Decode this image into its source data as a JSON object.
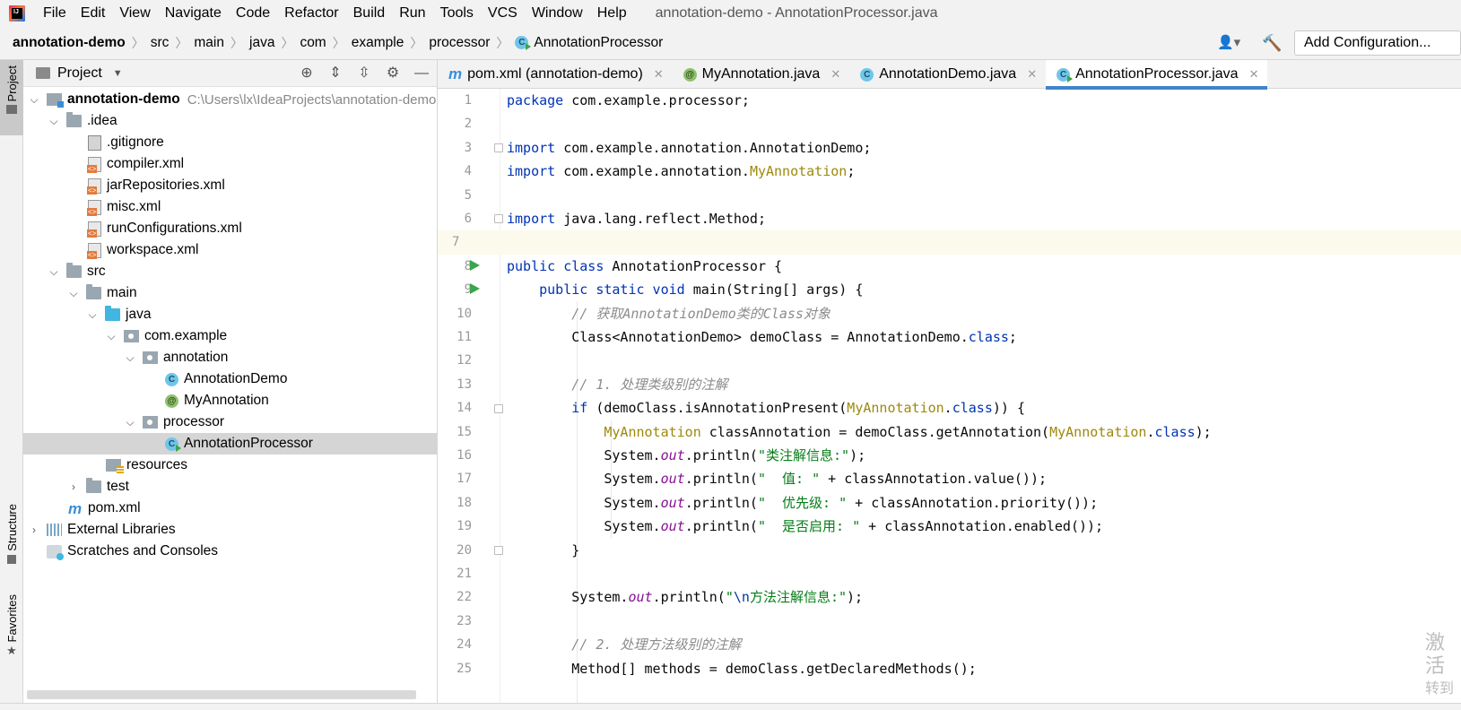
{
  "menubar": {
    "items": [
      "File",
      "Edit",
      "View",
      "Navigate",
      "Code",
      "Refactor",
      "Build",
      "Run",
      "Tools",
      "VCS",
      "Window",
      "Help"
    ],
    "window_title": "annotation-demo - AnnotationProcessor.java"
  },
  "breadcrumb": {
    "items": [
      "annotation-demo",
      "src",
      "main",
      "java",
      "com",
      "example",
      "processor",
      "AnnotationProcessor"
    ],
    "add_configuration": "Add Configuration..."
  },
  "leftstrip": {
    "project": "Project",
    "structure": "Structure",
    "favorites": "Favorites"
  },
  "project_panel": {
    "title": "Project",
    "root_name": "annotation-demo",
    "root_path": "C:\\Users\\lx\\IdeaProjects\\annotation-demo",
    "rows": [
      {
        "label": ".idea"
      },
      {
        "label": ".gitignore"
      },
      {
        "label": "compiler.xml"
      },
      {
        "label": "jarRepositories.xml"
      },
      {
        "label": "misc.xml"
      },
      {
        "label": "runConfigurations.xml"
      },
      {
        "label": "workspace.xml"
      },
      {
        "label": "src"
      },
      {
        "label": "main"
      },
      {
        "label": "java"
      },
      {
        "label": "com.example"
      },
      {
        "label": "annotation"
      },
      {
        "label": "AnnotationDemo"
      },
      {
        "label": "MyAnnotation"
      },
      {
        "label": "processor"
      },
      {
        "label": "AnnotationProcessor"
      },
      {
        "label": "resources"
      },
      {
        "label": "test"
      },
      {
        "label": "pom.xml"
      },
      {
        "label": "External Libraries"
      },
      {
        "label": "Scratches and Consoles"
      }
    ]
  },
  "editor": {
    "tabs": [
      {
        "label": "pom.xml (annotation-demo)"
      },
      {
        "label": "MyAnnotation.java"
      },
      {
        "label": "AnnotationDemo.java"
      },
      {
        "label": "AnnotationProcessor.java"
      }
    ],
    "line_numbers": [
      "1",
      "2",
      "3",
      "4",
      "5",
      "6",
      "7",
      "8",
      "9",
      "10",
      "11",
      "12",
      "13",
      "14",
      "15",
      "16",
      "17",
      "18",
      "19",
      "20",
      "21",
      "22",
      "23",
      "24",
      "25"
    ],
    "code": {
      "l1_kw": "package",
      "l1_rest": " com.example.processor;",
      "l3_kw": "import",
      "l3_rest": " com.example.annotation.AnnotationDemo;",
      "l4_kw": "import",
      "l4_rest": " com.example.annotation.",
      "l4_an": "MyAnnotation",
      "l4_end": ";",
      "l6_kw": "import",
      "l6_rest": " java.lang.reflect.Method;",
      "l8_kw": "public class",
      "l8_rest": " AnnotationProcessor {",
      "l9_kw": "    public static void",
      "l9_rest": " main(String[] args) {",
      "l10_cm": "        // 获取AnnotationDemo类的Class对象",
      "l11_a": "        Class<AnnotationDemo> demoClass = AnnotationDemo.",
      "l11_kw": "class",
      "l11_end": ";",
      "l13_cm": "        // 1. 处理类级别的注解",
      "l14_kw": "        if",
      "l14_a": " (demoClass.isAnnotationPresent(",
      "l14_an": "MyAnnotation",
      "l14_b": ".",
      "l14_kw2": "class",
      "l14_end": ")) {",
      "l15_an": "            MyAnnotation",
      "l15_a": " classAnnotation = demoClass.getAnnotation(",
      "l15_an2": "MyAnnotation",
      "l15_b": ".",
      "l15_kw": "class",
      "l15_end": ");",
      "l16_a": "            System.",
      "l16_it": "out",
      "l16_b": ".println(",
      "l16_st": "\"类注解信息:\"",
      "l16_end": ");",
      "l17_a": "            System.",
      "l17_it": "out",
      "l17_b": ".println(",
      "l17_st": "\"  值: \"",
      "l17_end": " + classAnnotation.value());",
      "l18_a": "            System.",
      "l18_it": "out",
      "l18_b": ".println(",
      "l18_st": "\"  优先级: \"",
      "l18_end": " + classAnnotation.priority());",
      "l19_a": "            System.",
      "l19_it": "out",
      "l19_b": ".println(",
      "l19_st": "\"  是否启用: \"",
      "l19_end": " + classAnnotation.enabled());",
      "l20": "        }",
      "l22_a": "        System.",
      "l22_it": "out",
      "l22_b": ".println(",
      "l22_q": "\"",
      "l22_esc": "\\n",
      "l22_st": "方法注解信息:\"",
      "l22_end": ");",
      "l24_cm": "        // 2. 处理方法级别的注解",
      "l25": "        Method[] methods = demoClass.getDeclaredMethods();"
    }
  },
  "watermark": {
    "line1": "激活",
    "line2": "转到"
  }
}
